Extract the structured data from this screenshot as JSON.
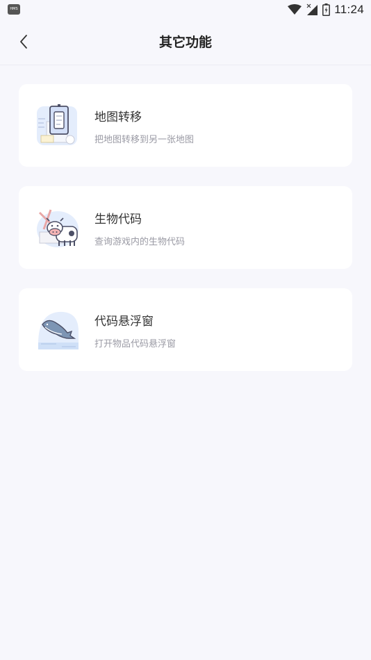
{
  "status_bar": {
    "time": "11:24",
    "left_icon_text": "HMS",
    "icons": [
      "wifi-icon",
      "cell-signal-icon",
      "battery-icon"
    ]
  },
  "header": {
    "title": "其它功能",
    "back_icon": "chevron-left-icon"
  },
  "features": [
    {
      "title": "地图转移",
      "description": "把地图转移到另一张地图",
      "icon": "map-transfer-illustration"
    },
    {
      "title": "生物代码",
      "description": "查询游戏内的生物代码",
      "icon": "cow-illustration"
    },
    {
      "title": "代码悬浮窗",
      "description": "打开物品代码悬浮窗",
      "icon": "whale-illustration"
    }
  ],
  "colors": {
    "background": "#f7f7fc",
    "card": "#ffffff",
    "title": "#333333",
    "description": "#9a9aa4",
    "illustration_blue": "#d8e4fb"
  }
}
